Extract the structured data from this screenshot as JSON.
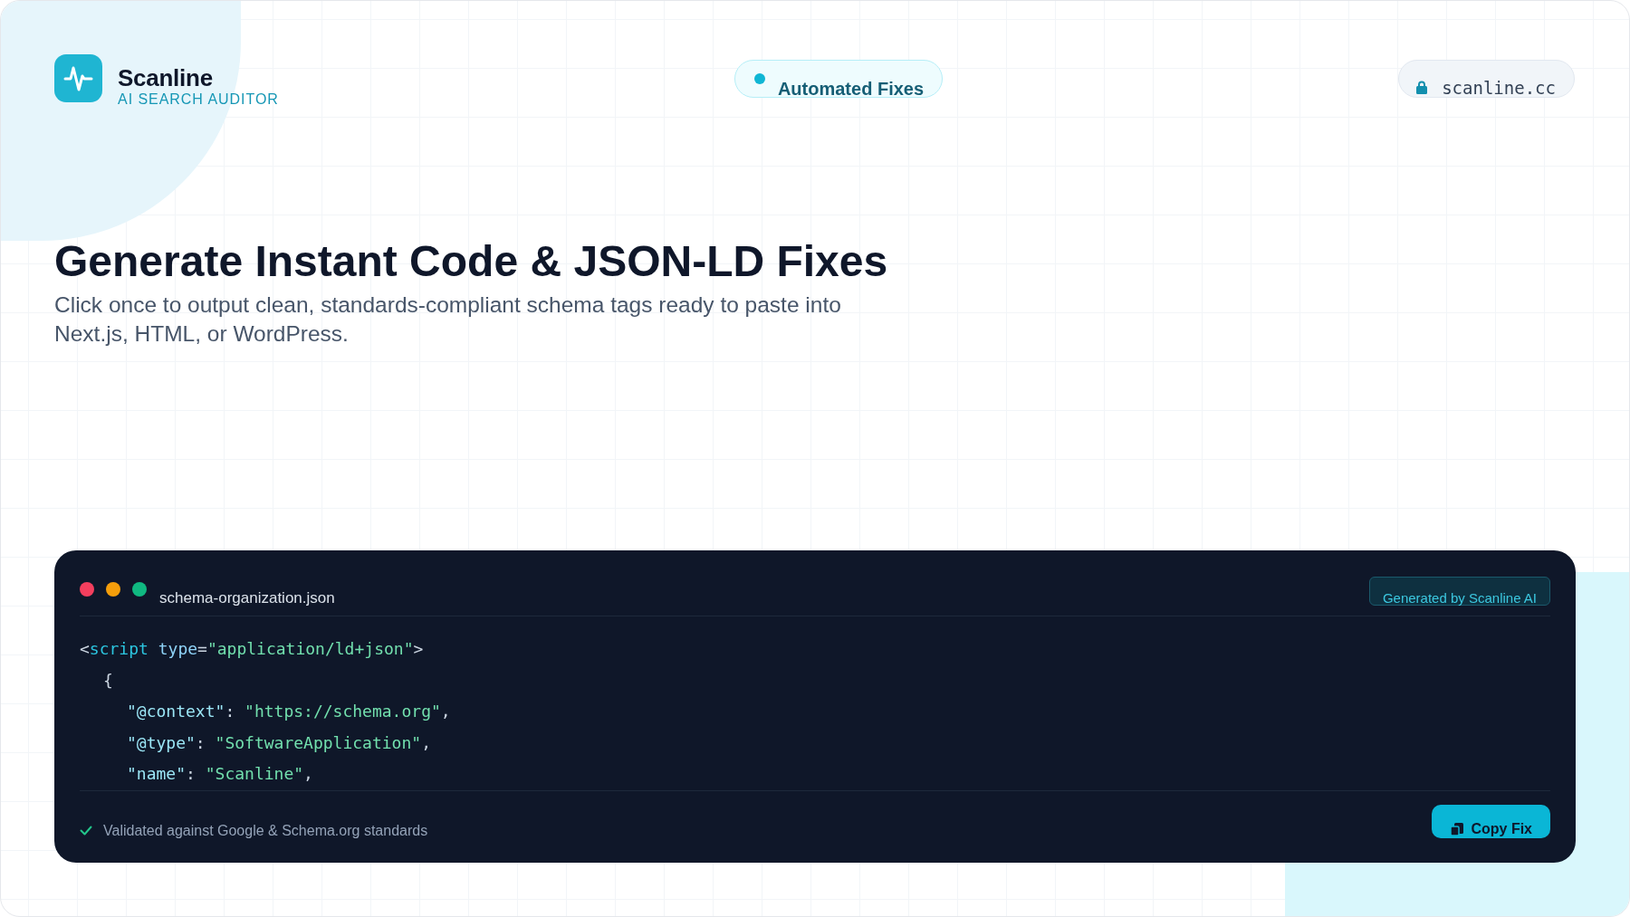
{
  "brand": {
    "name": "Scanline",
    "tagline": "AI SEARCH AUDITOR"
  },
  "header": {
    "badge": "Automated Fixes",
    "domain": "scanline.cc"
  },
  "hero": {
    "title": "Generate Instant Code & JSON-LD Fixes",
    "subtitle": "Click once to output clean, standards-compliant schema tags ready to paste into Next.js, HTML, or WordPress."
  },
  "code_window": {
    "window_controls": [
      {
        "color": "#f43f5e"
      },
      {
        "color": "#f59e0b"
      },
      {
        "color": "#10b981"
      }
    ],
    "filename": "schema-organization.json",
    "badge": "Generated by Scanline AI",
    "lines": [
      {
        "tokens": [
          {
            "kind": "punct",
            "text": "<"
          },
          {
            "kind": "tag",
            "text": "script"
          },
          {
            "kind": "attr",
            "text": " type"
          },
          {
            "kind": "punct",
            "text": "="
          },
          {
            "kind": "string",
            "text": "\"application/ld+json\""
          },
          {
            "kind": "punct",
            "text": ">"
          }
        ],
        "children": [
          {
            "tokens": [
              {
                "kind": "punct",
                "text": "{"
              }
            ],
            "children": [
              {
                "tokens": [
                  {
                    "kind": "key",
                    "text": "\"@context\""
                  },
                  {
                    "kind": "punct",
                    "text": ": "
                  },
                  {
                    "kind": "string",
                    "text": "\"https://schema.org\""
                  },
                  {
                    "kind": "punct",
                    "text": ","
                  }
                ]
              },
              {
                "tokens": [
                  {
                    "kind": "key",
                    "text": "\"@type\""
                  },
                  {
                    "kind": "punct",
                    "text": ": "
                  },
                  {
                    "kind": "string",
                    "text": "\"SoftwareApplication\""
                  },
                  {
                    "kind": "punct",
                    "text": ","
                  }
                ]
              },
              {
                "tokens": [
                  {
                    "kind": "key",
                    "text": "\"name\""
                  },
                  {
                    "kind": "punct",
                    "text": ": "
                  },
                  {
                    "kind": "string",
                    "text": "\"Scanline\""
                  },
                  {
                    "kind": "punct",
                    "text": ","
                  }
                ]
              }
            ]
          }
        ]
      }
    ],
    "note": "Validated against Google & Schema.org standards",
    "copy_button": "Copy Fix"
  }
}
